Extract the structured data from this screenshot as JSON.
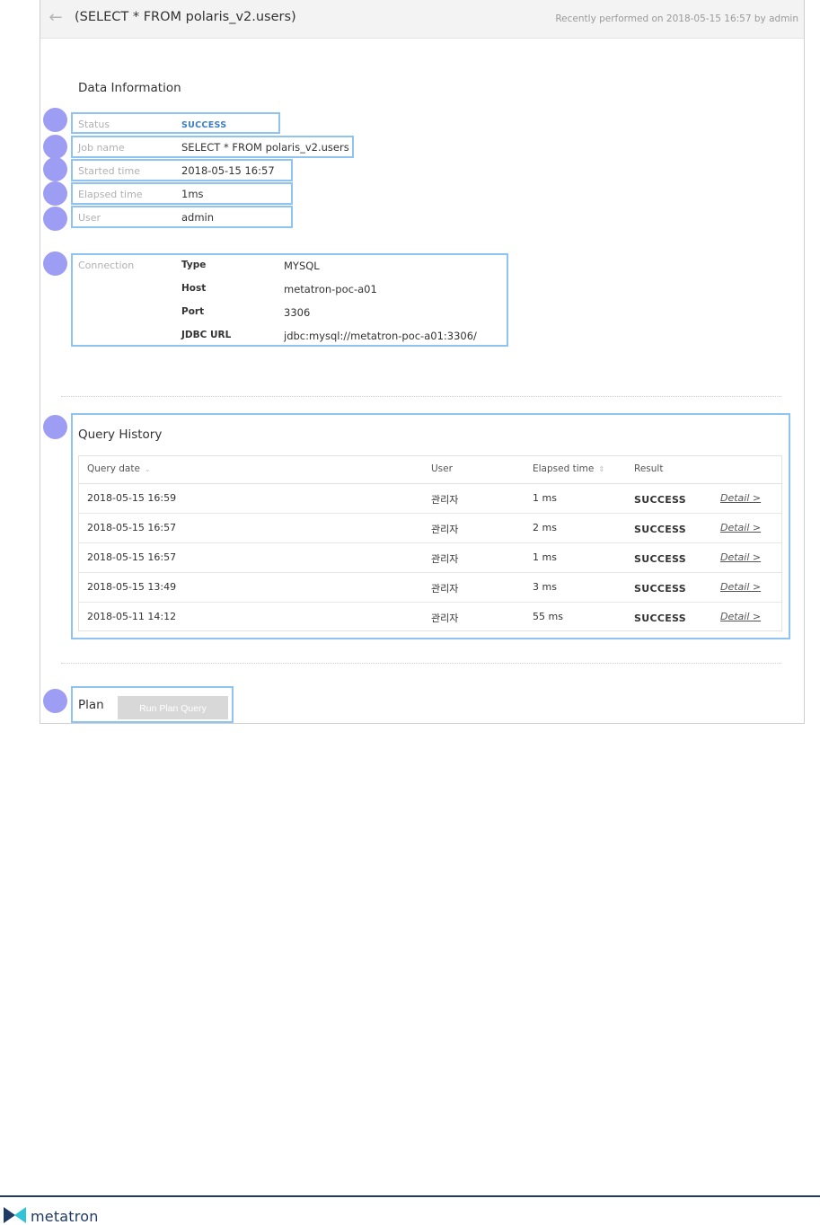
{
  "header": {
    "back_icon": "arrow-left-icon",
    "title": "(SELECT * FROM polaris_v2.users)",
    "meta": "Recently performed on 2018-05-15 16:57 by admin"
  },
  "data_info": {
    "title": "Data Information",
    "status_label": "Status",
    "status_value": "SUCCESS",
    "job_label": "Job name",
    "job_value": "SELECT * FROM polaris_v2.users",
    "started_label": "Started time",
    "started_value": "2018-05-15 16:57",
    "elapsed_label": "Elapsed time",
    "elapsed_value": "1ms",
    "user_label": "User",
    "user_value": "admin"
  },
  "connection": {
    "label": "Connection",
    "type_key": "Type",
    "type_value": "MYSQL",
    "host_key": "Host",
    "host_value": "metatron-poc-a01",
    "port_key": "Port",
    "port_value": "3306",
    "url_key": "JDBC URL",
    "url_value": "jdbc:mysql://metatron-poc-a01:3306/"
  },
  "history": {
    "title": "Query History",
    "columns": [
      "Query date",
      "User",
      "Elapsed time",
      "Result"
    ],
    "rows": [
      {
        "date": "2018-05-15 16:59",
        "user": "관리자",
        "elapsed": "1 ms",
        "result": "SUCCESS",
        "detail": "Detail >"
      },
      {
        "date": "2018-05-15 16:57",
        "user": "관리자",
        "elapsed": "2 ms",
        "result": "SUCCESS",
        "detail": "Detail >"
      },
      {
        "date": "2018-05-15 16:57",
        "user": "관리자",
        "elapsed": "1 ms",
        "result": "SUCCESS",
        "detail": "Detail >"
      },
      {
        "date": "2018-05-15 13:49",
        "user": "관리자",
        "elapsed": "3 ms",
        "result": "SUCCESS",
        "detail": "Detail >"
      },
      {
        "date": "2018-05-11 14:12",
        "user": "관리자",
        "elapsed": "55 ms",
        "result": "SUCCESS",
        "detail": "Detail >"
      }
    ]
  },
  "plan": {
    "title": "Plan",
    "button_label": "Run Plan Query"
  },
  "footer": {
    "brand": "metatron"
  },
  "colors": {
    "marker": "#9d9df3",
    "highlight": "#8ec3f2",
    "success": "#3d7fc4",
    "brand": "#1f3a63"
  }
}
